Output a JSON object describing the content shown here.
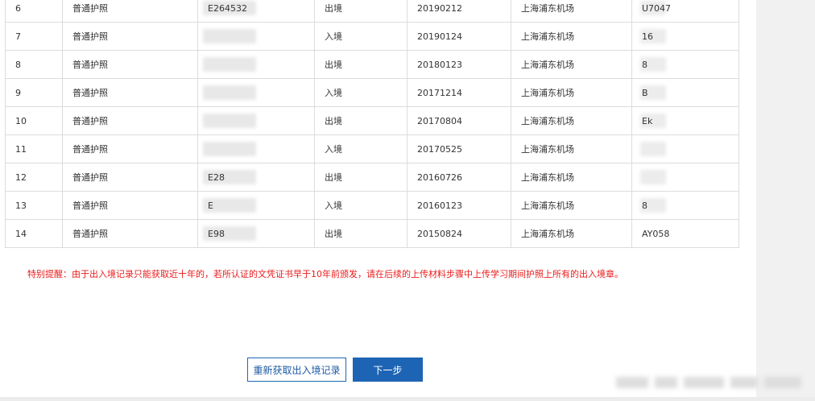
{
  "records": [
    {
      "no": "6",
      "type": "普通护照",
      "doc": "E264532",
      "direction": "出境",
      "date": "20190212",
      "port": "上海浦东机场",
      "flight": "U7047",
      "doc_masked": true,
      "flight_masked": true
    },
    {
      "no": "7",
      "type": "普通护照",
      "doc": "",
      "direction": "入境",
      "date": "20190124",
      "port": "上海浦东机场",
      "flight": "16",
      "doc_masked": true,
      "flight_masked": true
    },
    {
      "no": "8",
      "type": "普通护照",
      "doc": "",
      "direction": "出境",
      "date": "20180123",
      "port": "上海浦东机场",
      "flight": "8",
      "doc_masked": true,
      "flight_masked": true
    },
    {
      "no": "9",
      "type": "普通护照",
      "doc": "",
      "direction": "入境",
      "date": "20171214",
      "port": "上海浦东机场",
      "flight": "B",
      "doc_masked": true,
      "flight_masked": true
    },
    {
      "no": "10",
      "type": "普通护照",
      "doc": "",
      "direction": "出境",
      "date": "20170804",
      "port": "上海浦东机场",
      "flight": "Ek",
      "doc_masked": true,
      "flight_masked": true
    },
    {
      "no": "11",
      "type": "普通护照",
      "doc": "",
      "direction": "入境",
      "date": "20170525",
      "port": "上海浦东机场",
      "flight": "",
      "doc_masked": true,
      "flight_masked": true
    },
    {
      "no": "12",
      "type": "普通护照",
      "doc": "E28",
      "direction": "出境",
      "date": "20160726",
      "port": "上海浦东机场",
      "flight": "",
      "doc_masked": true,
      "flight_masked": true
    },
    {
      "no": "13",
      "type": "普通护照",
      "doc": "E",
      "direction": "入境",
      "date": "20160123",
      "port": "上海浦东机场",
      "flight": "8",
      "doc_masked": true,
      "flight_masked": true
    },
    {
      "no": "14",
      "type": "普通护照",
      "doc": "E98",
      "direction": "出境",
      "date": "20150824",
      "port": "上海浦东机场",
      "flight": "AY058",
      "doc_masked": true,
      "flight_masked": false
    }
  ],
  "notice": "特别提醒：由于出入境记录只能获取近十年的，若所认证的文凭证书早于10年前颁发，请在后续的上传材料步骤中上传学习期间护照上所有的出入境章。",
  "buttons": {
    "refresh": "重新获取出入境记录",
    "next": "下一步"
  }
}
